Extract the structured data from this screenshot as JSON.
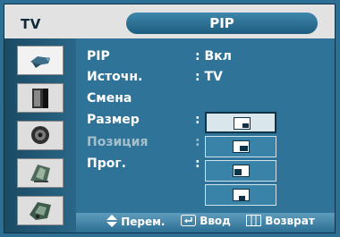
{
  "header": {
    "source_label": "TV",
    "title": "PIP"
  },
  "sidebar": {
    "icons": [
      {
        "name": "picture-icon",
        "active": true
      },
      {
        "name": "sound-icon",
        "active": false
      },
      {
        "name": "channel-icon",
        "active": false
      },
      {
        "name": "setup-icon",
        "active": false
      },
      {
        "name": "input-icon",
        "active": false
      }
    ]
  },
  "menu": {
    "items": [
      {
        "label": "PIP",
        "value": ": Вкл",
        "dim": false
      },
      {
        "label": "Источн.",
        "value": ": TV",
        "dim": false
      },
      {
        "label": "Смена",
        "value": "",
        "dim": false
      },
      {
        "label": "Размер",
        "value": ":",
        "dim": false
      },
      {
        "label": "Позиция",
        "value": ":",
        "dim": true
      },
      {
        "label": "Прог.",
        "value": ":",
        "dim": false
      }
    ],
    "size_options": [
      {
        "name": "size-option-small",
        "selected": true
      },
      {
        "name": "size-option-large",
        "selected": false
      },
      {
        "name": "size-option-double-left",
        "selected": false
      },
      {
        "name": "size-option-double-bottom",
        "selected": false
      }
    ]
  },
  "footer": {
    "move_label": "Перем.",
    "enter_label": "Ввод",
    "return_label": "Возврат"
  }
}
